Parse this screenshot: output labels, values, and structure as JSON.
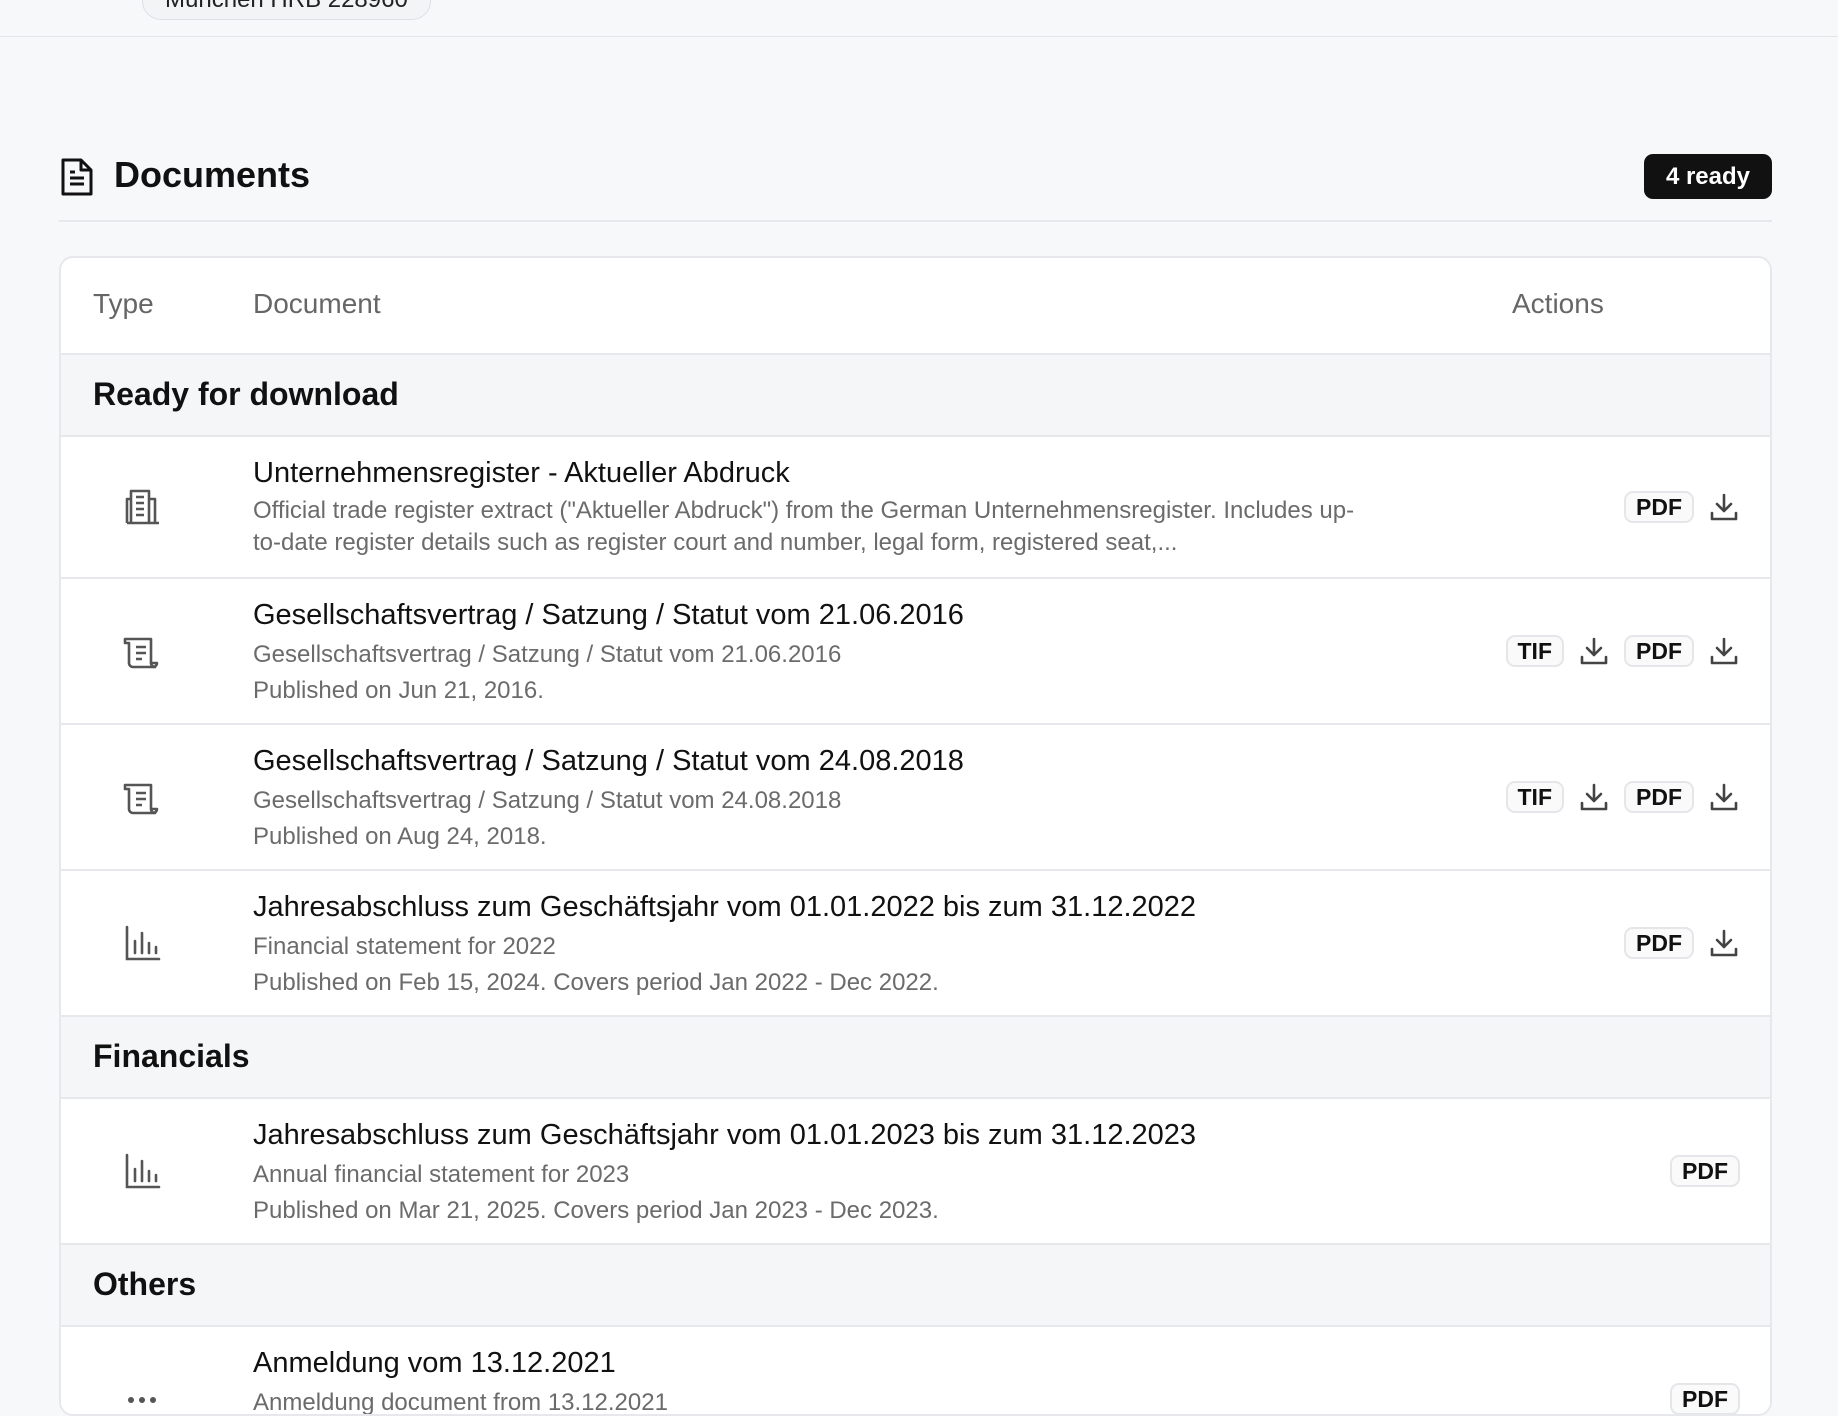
{
  "topbar": {
    "register_pill": "München HRB 228960"
  },
  "section": {
    "title": "Documents",
    "badge": "4 ready"
  },
  "table": {
    "col_type": "Type",
    "col_document": "Document",
    "col_actions": "Actions"
  },
  "groups": {
    "ready": {
      "label": "Ready for download",
      "rows": [
        {
          "icon": "building-icon",
          "title": "Unternehmensregister - Aktueller Abdruck",
          "desc1": "Official trade register extract (\"Aktueller Abdruck\") from the German Unternehmensregister. Includes up-",
          "desc2": "to-date register details such as register court and number, legal form, registered seat,...",
          "formats": [
            "PDF"
          ]
        },
        {
          "icon": "scroll-icon",
          "title": "Gesellschaftsvertrag / Satzung / Statut vom 21.06.2016",
          "desc1": "Gesellschaftsvertrag / Satzung / Statut vom 21.06.2016",
          "desc2": "Published on Jun 21, 2016.",
          "formats": [
            "TIF",
            "PDF"
          ]
        },
        {
          "icon": "scroll-icon",
          "title": "Gesellschaftsvertrag / Satzung / Statut vom 24.08.2018",
          "desc1": "Gesellschaftsvertrag / Satzung / Statut vom 24.08.2018",
          "desc2": "Published on Aug 24, 2018.",
          "formats": [
            "TIF",
            "PDF"
          ]
        },
        {
          "icon": "bar-chart-icon",
          "title": "Jahresabschluss zum Geschäftsjahr vom 01.01.2022 bis zum 31.12.2022",
          "desc1": "Financial statement for 2022",
          "desc2": "Published on Feb 15, 2024. Covers period Jan 2022 - Dec 2022.",
          "formats": [
            "PDF"
          ]
        }
      ]
    },
    "financials": {
      "label": "Financials",
      "rows": [
        {
          "icon": "bar-chart-icon",
          "title": "Jahresabschluss zum Geschäftsjahr vom 01.01.2023 bis zum 31.12.2023",
          "desc1": "Annual financial statement for 2023",
          "desc2": "Published on Mar 21, 2025. Covers period Jan 2023 - Dec 2023.",
          "formats": [
            "PDF"
          ]
        }
      ]
    },
    "others": {
      "label": "Others",
      "rows": [
        {
          "icon": "more-dots-icon",
          "title": "Anmeldung vom 13.12.2021",
          "desc1": "Anmeldung document from 13.12.2021",
          "formats": [
            "PDF"
          ]
        }
      ]
    }
  }
}
